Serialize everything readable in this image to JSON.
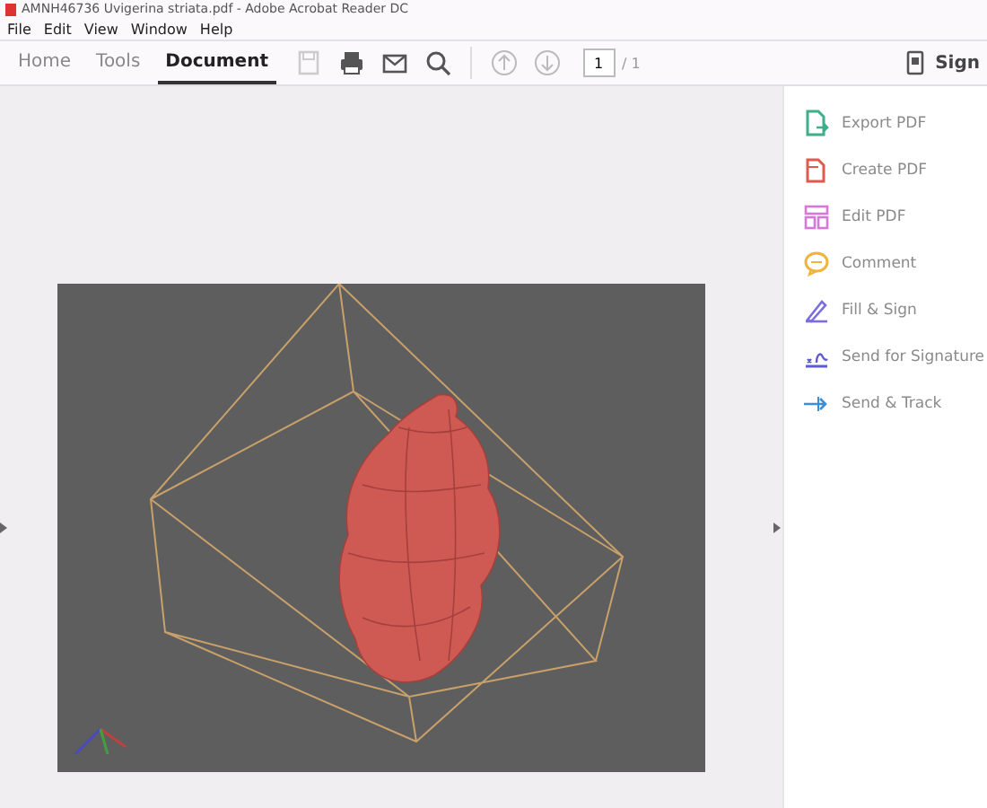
{
  "window": {
    "title": "AMNH46736 Uvigerina striata.pdf - Adobe Acrobat Reader DC"
  },
  "menu": [
    "File",
    "Edit",
    "View",
    "Window",
    "Help"
  ],
  "tabs": [
    {
      "label": "Home",
      "selected": false
    },
    {
      "label": "Tools",
      "selected": false
    },
    {
      "label": "Document",
      "selected": true
    }
  ],
  "toolbar": {
    "page_field": {
      "value": "1"
    },
    "page_total": "/ 1",
    "sign_label": "Sign"
  },
  "tools": [
    {
      "label": "Export PDF",
      "kind": "export",
      "color": "#3fae8a"
    },
    {
      "label": "Create PDF",
      "kind": "create",
      "color": "#e05a4e"
    },
    {
      "label": "Edit PDF",
      "kind": "edit",
      "color": "#d877d8"
    },
    {
      "label": "Comment",
      "kind": "comment",
      "color": "#f0b43a"
    },
    {
      "label": "Fill & Sign",
      "kind": "fill",
      "color": "#7a6ee0"
    },
    {
      "label": "Send for Signature",
      "kind": "signature",
      "color": "#5b5bd6"
    },
    {
      "label": "Send & Track",
      "kind": "track",
      "color": "#3a8fd8"
    }
  ]
}
